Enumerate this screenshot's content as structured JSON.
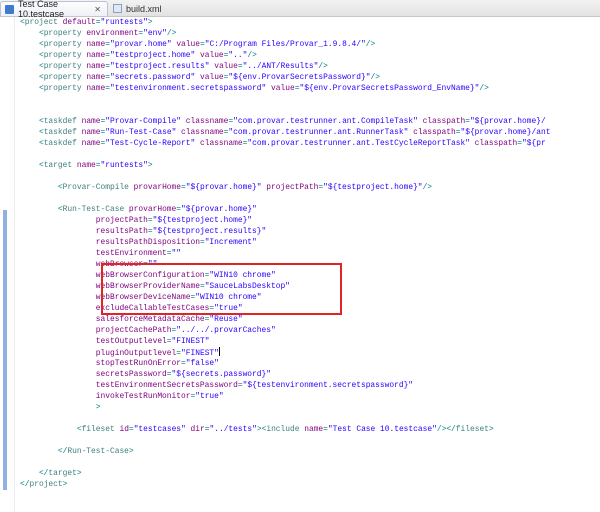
{
  "tabs": [
    {
      "label": "Test Case 10.testcase",
      "icon": "testcase-file-icon",
      "close": "✕"
    },
    {
      "label": "build.xml",
      "icon": "xml-file-icon",
      "close": ""
    }
  ],
  "lines": [
    [
      [
        "p",
        "<"
      ],
      [
        "t",
        "project"
      ],
      [
        "a",
        " default"
      ],
      [
        "p",
        "="
      ],
      [
        "v",
        "\"runtests\""
      ],
      [
        "p",
        ">"
      ]
    ],
    [
      [
        "p",
        "    <"
      ],
      [
        "t",
        "property"
      ],
      [
        "a",
        " environment"
      ],
      [
        "p",
        "="
      ],
      [
        "v",
        "\"env\""
      ],
      [
        "p",
        "/>"
      ]
    ],
    [
      [
        "p",
        "    <"
      ],
      [
        "t",
        "property"
      ],
      [
        "a",
        " name"
      ],
      [
        "p",
        "="
      ],
      [
        "v",
        "\"provar.home\""
      ],
      [
        "a",
        " value"
      ],
      [
        "p",
        "="
      ],
      [
        "v",
        "\"C:/Program Files/Provar_1.9.8.4/\""
      ],
      [
        "p",
        "/>"
      ]
    ],
    [
      [
        "p",
        "    <"
      ],
      [
        "t",
        "property"
      ],
      [
        "a",
        " name"
      ],
      [
        "p",
        "="
      ],
      [
        "v",
        "\"testproject.home\""
      ],
      [
        "a",
        " value"
      ],
      [
        "p",
        "="
      ],
      [
        "v",
        "\"..\""
      ],
      [
        "p",
        "/>"
      ]
    ],
    [
      [
        "p",
        "    <"
      ],
      [
        "t",
        "property"
      ],
      [
        "a",
        " name"
      ],
      [
        "p",
        "="
      ],
      [
        "v",
        "\"testproject.results\""
      ],
      [
        "a",
        " value"
      ],
      [
        "p",
        "="
      ],
      [
        "v",
        "\"../ANT/Results\""
      ],
      [
        "p",
        "/>"
      ]
    ],
    [
      [
        "p",
        "    <"
      ],
      [
        "t",
        "property"
      ],
      [
        "a",
        " name"
      ],
      [
        "p",
        "="
      ],
      [
        "v",
        "\"secrets.password\""
      ],
      [
        "a",
        " value"
      ],
      [
        "p",
        "="
      ],
      [
        "v",
        "\"${env.ProvarSecretsPassword}\""
      ],
      [
        "p",
        "/>"
      ]
    ],
    [
      [
        "p",
        "    <"
      ],
      [
        "t",
        "property"
      ],
      [
        "a",
        " name"
      ],
      [
        "p",
        "="
      ],
      [
        "v",
        "\"testenvironment.secretspassword\""
      ],
      [
        "a",
        " value"
      ],
      [
        "p",
        "="
      ],
      [
        "v",
        "\"${env.ProvarSecretsPassword_EnvName}\""
      ],
      [
        "p",
        "/>"
      ]
    ],
    [],
    [],
    [
      [
        "p",
        "    <"
      ],
      [
        "t",
        "taskdef"
      ],
      [
        "a",
        " name"
      ],
      [
        "p",
        "="
      ],
      [
        "v",
        "\"Provar-Compile\""
      ],
      [
        "a",
        " classname"
      ],
      [
        "p",
        "="
      ],
      [
        "v",
        "\"com.provar.testrunner.ant.CompileTask\""
      ],
      [
        "a",
        " classpath"
      ],
      [
        "p",
        "="
      ],
      [
        "v",
        "\"${provar.home}/"
      ]
    ],
    [
      [
        "p",
        "    <"
      ],
      [
        "t",
        "taskdef"
      ],
      [
        "a",
        " name"
      ],
      [
        "p",
        "="
      ],
      [
        "v",
        "\"Run-Test-Case\""
      ],
      [
        "a",
        " classname"
      ],
      [
        "p",
        "="
      ],
      [
        "v",
        "\"com.provar.testrunner.ant.RunnerTask\""
      ],
      [
        "a",
        " classpath"
      ],
      [
        "p",
        "="
      ],
      [
        "v",
        "\"${provar.home}/ant"
      ]
    ],
    [
      [
        "p",
        "    <"
      ],
      [
        "t",
        "taskdef"
      ],
      [
        "a",
        " name"
      ],
      [
        "p",
        "="
      ],
      [
        "v",
        "\"Test-Cycle-Report\""
      ],
      [
        "a",
        " classname"
      ],
      [
        "p",
        "="
      ],
      [
        "v",
        "\"com.provar.testrunner.ant.TestCycleReportTask\""
      ],
      [
        "a",
        " classpath"
      ],
      [
        "p",
        "="
      ],
      [
        "v",
        "\"${pr"
      ]
    ],
    [],
    [
      [
        "p",
        "    <"
      ],
      [
        "t",
        "target"
      ],
      [
        "a",
        " name"
      ],
      [
        "p",
        "="
      ],
      [
        "v",
        "\"runtests\""
      ],
      [
        "p",
        ">"
      ]
    ],
    [],
    [
      [
        "p",
        "        <"
      ],
      [
        "t",
        "Provar-Compile"
      ],
      [
        "a",
        " provarHome"
      ],
      [
        "p",
        "="
      ],
      [
        "v",
        "\"${provar.home}\""
      ],
      [
        "a",
        " projectPath"
      ],
      [
        "p",
        "="
      ],
      [
        "v",
        "\"${testproject.home}\""
      ],
      [
        "p",
        "/>"
      ]
    ],
    [],
    [
      [
        "p",
        "        <"
      ],
      [
        "t",
        "Run-Test-Case"
      ],
      [
        "a",
        " provarHome"
      ],
      [
        "p",
        "="
      ],
      [
        "v",
        "\"${provar.home}\""
      ]
    ],
    [
      [
        "a",
        "                projectPath"
      ],
      [
        "p",
        "="
      ],
      [
        "v",
        "\"${testproject.home}\""
      ]
    ],
    [
      [
        "a",
        "                resultsPath"
      ],
      [
        "p",
        "="
      ],
      [
        "v",
        "\"${testproject.results}\""
      ]
    ],
    [
      [
        "a",
        "                resultsPathDisposition"
      ],
      [
        "p",
        "="
      ],
      [
        "v",
        "\"Increment\""
      ]
    ],
    [
      [
        "a",
        "                testEnvironment"
      ],
      [
        "p",
        "="
      ],
      [
        "v",
        "\"\""
      ]
    ],
    [
      [
        "a",
        "                webBrowser"
      ],
      [
        "p",
        "="
      ],
      [
        "v",
        "\"\""
      ]
    ],
    [
      [
        "a",
        "                webBrowserConfiguration"
      ],
      [
        "p",
        "="
      ],
      [
        "v",
        "\"WIN10 chrome\""
      ]
    ],
    [
      [
        "a",
        "                webBrowserProviderName"
      ],
      [
        "p",
        "="
      ],
      [
        "v",
        "\"SauceLabsDesktop\""
      ]
    ],
    [
      [
        "a",
        "                webBrowserDeviceName"
      ],
      [
        "p",
        "="
      ],
      [
        "v",
        "\"WIN10 chrome\""
      ]
    ],
    [
      [
        "a",
        "                excludeCallableTestCases"
      ],
      [
        "p",
        "="
      ],
      [
        "v",
        "\"true\""
      ]
    ],
    [
      [
        "a",
        "                salesforceMetadataCache"
      ],
      [
        "p",
        "="
      ],
      [
        "v",
        "\"Reuse\""
      ]
    ],
    [
      [
        "a",
        "                projectCachePath"
      ],
      [
        "p",
        "="
      ],
      [
        "v",
        "\"../../.provarCaches\""
      ]
    ],
    [
      [
        "a",
        "                testOutputlevel"
      ],
      [
        "p",
        "="
      ],
      [
        "v",
        "\"FINEST\""
      ]
    ],
    [
      [
        "a",
        "                pluginOutputlevel"
      ],
      [
        "p",
        "="
      ],
      [
        "v",
        "\"FINEST\""
      ],
      [
        "c",
        ""
      ]
    ],
    [
      [
        "a",
        "                stopTestRunOnError"
      ],
      [
        "p",
        "="
      ],
      [
        "v",
        "\"false\""
      ]
    ],
    [
      [
        "a",
        "                secretsPassword"
      ],
      [
        "p",
        "="
      ],
      [
        "v",
        "\"${secrets.password}\""
      ]
    ],
    [
      [
        "a",
        "                testEnvironmentSecretsPassword"
      ],
      [
        "p",
        "="
      ],
      [
        "v",
        "\"${testenvironment.secretspassword}\""
      ]
    ],
    [
      [
        "a",
        "                invokeTestRunMonitor"
      ],
      [
        "p",
        "="
      ],
      [
        "v",
        "\"true\""
      ]
    ],
    [
      [
        "p",
        "                >"
      ]
    ],
    [],
    [
      [
        "p",
        "            <"
      ],
      [
        "t",
        "fileset"
      ],
      [
        "a",
        " id"
      ],
      [
        "p",
        "="
      ],
      [
        "v",
        "\"testcases\""
      ],
      [
        "a",
        " dir"
      ],
      [
        "p",
        "="
      ],
      [
        "v",
        "\"../tests\""
      ],
      [
        "p",
        "><"
      ],
      [
        "t",
        "include"
      ],
      [
        "a",
        " name"
      ],
      [
        "p",
        "="
      ],
      [
        "v",
        "\"Test Case 10.testcase\""
      ],
      [
        "p",
        "/></"
      ],
      [
        "t",
        "fileset"
      ],
      [
        "p",
        ">"
      ]
    ],
    [],
    [
      [
        "p",
        "        </"
      ],
      [
        "t",
        "Run-Test-Case"
      ],
      [
        "p",
        ">"
      ]
    ],
    [],
    [
      [
        "p",
        "    </"
      ],
      [
        "t",
        "target"
      ],
      [
        "p",
        ">"
      ]
    ],
    [
      [
        "p",
        "</"
      ],
      [
        "t",
        "project"
      ],
      [
        "p",
        ">"
      ]
    ]
  ]
}
